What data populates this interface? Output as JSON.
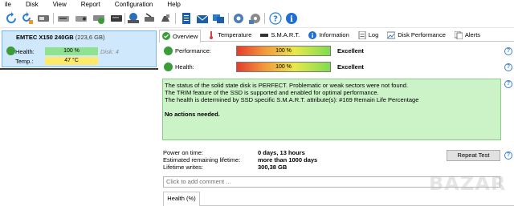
{
  "menu": [
    "ile",
    "Disk",
    "View",
    "Report",
    "Configuration",
    "Help"
  ],
  "toolbar_icons": [
    "refresh-icon",
    "refresh-all-icon",
    "drive-select-icon",
    "acoustic-icon",
    "power-icon",
    "drive-check-icon",
    "drive-dark-icon",
    "burn-icon",
    "tool-icon",
    "eject-icon",
    "report-icon",
    "mail-icon",
    "share-icon",
    "settings-icon",
    "options-icon",
    "help-icon",
    "info-icon"
  ],
  "disk": {
    "name": "EMTEC X150 240GB",
    "size": "(223,6 GB)",
    "health_label": "Health:",
    "health_value": "100 %",
    "temp_label": "Temp.:",
    "temp_value": "47 °C",
    "disk_number": "Disk: 4"
  },
  "tabs": [
    {
      "label": "Overview",
      "icon": "check-icon"
    },
    {
      "label": "Temperature",
      "icon": "thermometer-icon"
    },
    {
      "label": "S.M.A.R.T.",
      "icon": "smart-icon"
    },
    {
      "label": "Information",
      "icon": "info-icon"
    },
    {
      "label": "Log",
      "icon": "log-icon"
    },
    {
      "label": "Disk Performance",
      "icon": "performance-icon"
    },
    {
      "label": "Alerts",
      "icon": "alerts-icon"
    }
  ],
  "overview": {
    "performance_label": "Performance:",
    "performance_value": "100 %",
    "performance_percent": 100,
    "performance_status": "Excellent",
    "health_label": "Health:",
    "health_value": "100 %",
    "health_percent": 100,
    "health_status": "Excellent",
    "message_lines": [
      "The status of the solid state disk is PERFECT. Problematic or weak sectors were not found.",
      "The TRIM feature of the SSD is supported and enabled for optimal performance.",
      "The health is determined by SSD specific S.M.A.R.T. attribute(s):  #169 Remain Life Percentage"
    ],
    "actions": "No actions needed.",
    "power_on_label": "Power on time:",
    "power_on_value": "0 days, 13 hours",
    "remaining_label": "Estimated remaining lifetime:",
    "remaining_value": "more than 1000 days",
    "writes_label": "Lifetime writes:",
    "writes_value": "300,38 GB",
    "repeat_test": "Repeat Test",
    "comment_placeholder": "Click to add comment ...",
    "bottom_tab": "Health (%)"
  },
  "colors": {
    "green": "#3a9d3a",
    "selected_bg": "#cfe8fb",
    "info_bg": "#ccf2c8",
    "accent_blue": "#3b7fd0"
  }
}
